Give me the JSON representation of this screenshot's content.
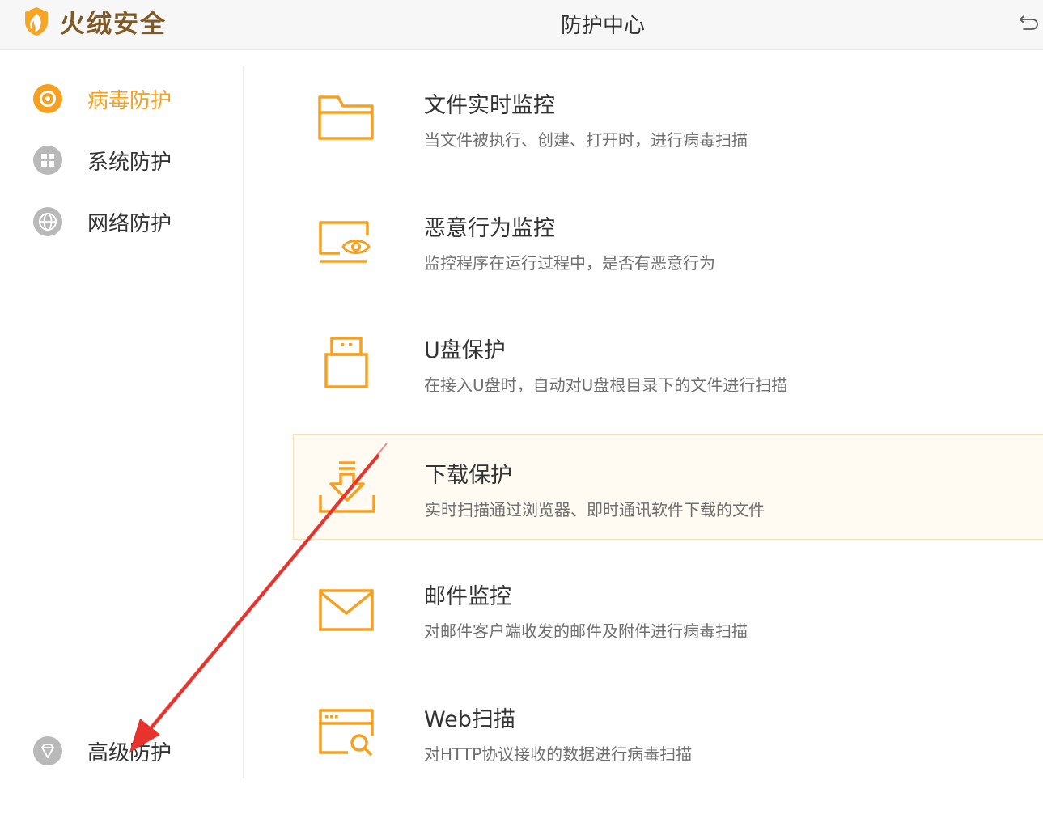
{
  "app": {
    "name": "火绒安全",
    "page_title": "防护中心",
    "back_icon": "back-icon"
  },
  "sidebar": {
    "items": [
      {
        "label": "病毒防护",
        "icon": "virus-protection-icon",
        "active": true
      },
      {
        "label": "系统防护",
        "icon": "windows-icon",
        "active": false
      },
      {
        "label": "网络防护",
        "icon": "globe-icon",
        "active": false
      },
      {
        "label": "高级防护",
        "icon": "diamond-icon",
        "active": false
      }
    ]
  },
  "features": [
    {
      "title": "文件实时监控",
      "desc": "当文件被执行、创建、打开时，进行病毒扫描",
      "icon": "folder-icon"
    },
    {
      "title": "恶意行为监控",
      "desc": "监控程序在运行过程中，是否有恶意行为",
      "icon": "monitor-eye-icon"
    },
    {
      "title": "U盘保护",
      "desc": "在接入U盘时，自动对U盘根目录下的文件进行扫描",
      "icon": "usb-drive-icon"
    },
    {
      "title": "下载保护",
      "desc": "实时扫描通过浏览器、即时通讯软件下载的文件",
      "icon": "download-icon"
    },
    {
      "title": "邮件监控",
      "desc": "对邮件客户端收发的邮件及附件进行病毒扫描",
      "icon": "mail-icon"
    },
    {
      "title": "Web扫描",
      "desc": "对HTTP协议接收的数据进行病毒扫描",
      "icon": "web-scan-icon"
    }
  ],
  "colors": {
    "accent": "#f5a020",
    "brand_text": "#7d5a26",
    "nav_icon_gray": "#b9b9b9",
    "annotation_arrow": "#e8322c"
  }
}
